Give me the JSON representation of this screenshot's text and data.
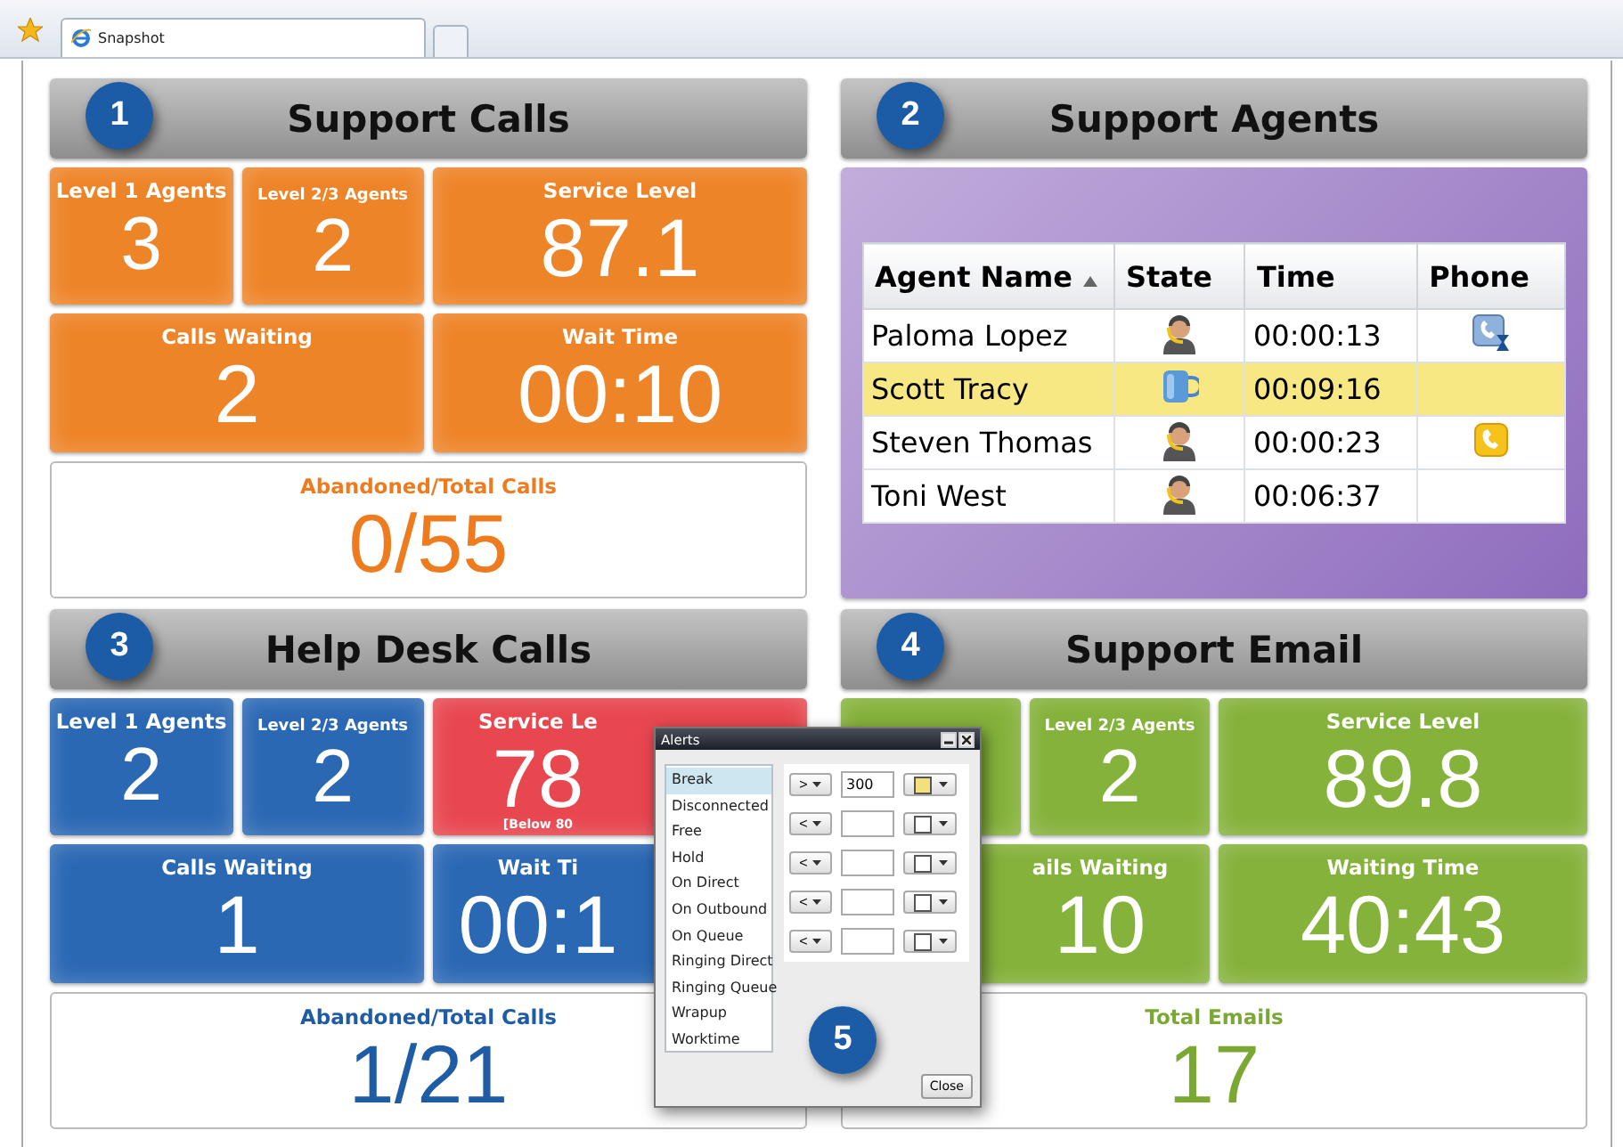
{
  "browser": {
    "tabs": [
      {
        "title": "Snapshot",
        "selected": true
      }
    ]
  },
  "sections": [
    {
      "kind": "metrics",
      "badge": "1",
      "title": "Support Calls",
      "tiles": [
        {
          "kind": "small",
          "label": "Level 1 Agents",
          "value": "3",
          "color": "#ee8428"
        },
        {
          "kind": "small",
          "label": "Level 2/3 Agents",
          "value": "2",
          "color": "#ee8428"
        },
        {
          "kind": "wide",
          "label": "Service Level",
          "value": "87.1",
          "color": "#ee8428"
        },
        {
          "kind": "wide",
          "label": "Calls Waiting",
          "value": "2",
          "color": "#ee8428"
        },
        {
          "kind": "wide",
          "label": "Wait Time",
          "value": "00:10",
          "color": "#ee8428"
        },
        {
          "kind": "total",
          "label": "Abandoned/Total Calls",
          "value": "0/55",
          "color": "#ef7b1f"
        }
      ]
    },
    {
      "kind": "agents",
      "badge": "2",
      "title": "Support Agents",
      "table": {
        "columns": [
          {
            "label": "Agent Name",
            "sorted": true
          },
          {
            "label": "State",
            "sorted": false
          },
          {
            "label": "Time",
            "sorted": false
          },
          {
            "label": "Phone",
            "sorted": false
          }
        ],
        "rows": [
          {
            "name": "Paloma Lopez",
            "state": {
              "kind": "agent"
            },
            "time": "00:00:13",
            "phone": {
              "kind": "hold"
            },
            "selected": false
          },
          {
            "name": "Scott Tracy",
            "state": {
              "kind": "break"
            },
            "time": "00:09:16",
            "selected": true
          },
          {
            "name": "Steven Thomas",
            "state": {
              "kind": "agent"
            },
            "time": "00:00:23",
            "phone": {
              "kind": "ringing"
            },
            "selected": false
          },
          {
            "name": "Toni West",
            "state": {
              "kind": "agent"
            },
            "time": "00:06:37",
            "selected": false
          }
        ]
      }
    },
    {
      "kind": "metrics",
      "badge": "3",
      "title": "Help Desk Calls",
      "tiles": [
        {
          "kind": "small",
          "label": "Level 1 Agents",
          "value": "2",
          "color": "#2b68b4"
        },
        {
          "kind": "small",
          "label": "Level 2/3 Agents",
          "value": "2",
          "color": "#2b68b4"
        },
        {
          "kind": "wide",
          "label": "Service Le",
          "value": "78",
          "note": "[Below 80",
          "color": "#e8474f"
        },
        {
          "kind": "wide",
          "label": "Calls Waiting",
          "value": "1",
          "color": "#2b68b4"
        },
        {
          "kind": "wide",
          "label": "Wait Ti",
          "value": "00:1",
          "color": "#2b68b4"
        },
        {
          "kind": "total",
          "label": "Abandoned/Total Calls",
          "value": "1/21",
          "color": "#1f5ca6"
        }
      ]
    },
    {
      "kind": "metrics",
      "badge": "4",
      "title": "Support Email",
      "tiles": [
        {
          "kind": "small",
          "color": "#84b23a"
        },
        {
          "kind": "small",
          "label": "Level 2/3 Agents",
          "value": "2",
          "color": "#84b23a"
        },
        {
          "kind": "wide",
          "label": "Service Level",
          "value": "89.8",
          "color": "#84b23a"
        },
        {
          "kind": "wide",
          "label": "ails Waiting",
          "value": "10",
          "color": "#84b23a"
        },
        {
          "kind": "wide",
          "label": "Waiting Time",
          "value": "40:43",
          "color": "#84b23a"
        },
        {
          "kind": "total",
          "label": "Total Emails",
          "value": "17",
          "color": "#7aa832"
        }
      ]
    }
  ],
  "dialog": {
    "title": "Alerts",
    "badge": "5",
    "states": [
      {
        "label": "Break",
        "selected": true
      },
      {
        "label": "Disconnected",
        "selected": false
      },
      {
        "label": "Free",
        "selected": false
      },
      {
        "label": "Hold",
        "selected": false
      },
      {
        "label": "On Direct",
        "selected": false
      },
      {
        "label": "On Outbound",
        "selected": false
      },
      {
        "label": "On Queue",
        "selected": false
      },
      {
        "label": "Ringing Direct",
        "selected": false
      },
      {
        "label": "Ringing Queue",
        "selected": false
      },
      {
        "label": "Wrapup",
        "selected": false
      },
      {
        "label": "Worktime",
        "selected": false
      }
    ],
    "rules": [
      {
        "operator": ">",
        "value": "300",
        "color": "#f3e07a"
      },
      {
        "operator": "<",
        "color": "#ffffff"
      },
      {
        "operator": "<",
        "color": "#ffffff"
      },
      {
        "operator": "<",
        "color": "#ffffff"
      },
      {
        "operator": "<",
        "color": "#ffffff"
      }
    ],
    "close": "Close"
  }
}
